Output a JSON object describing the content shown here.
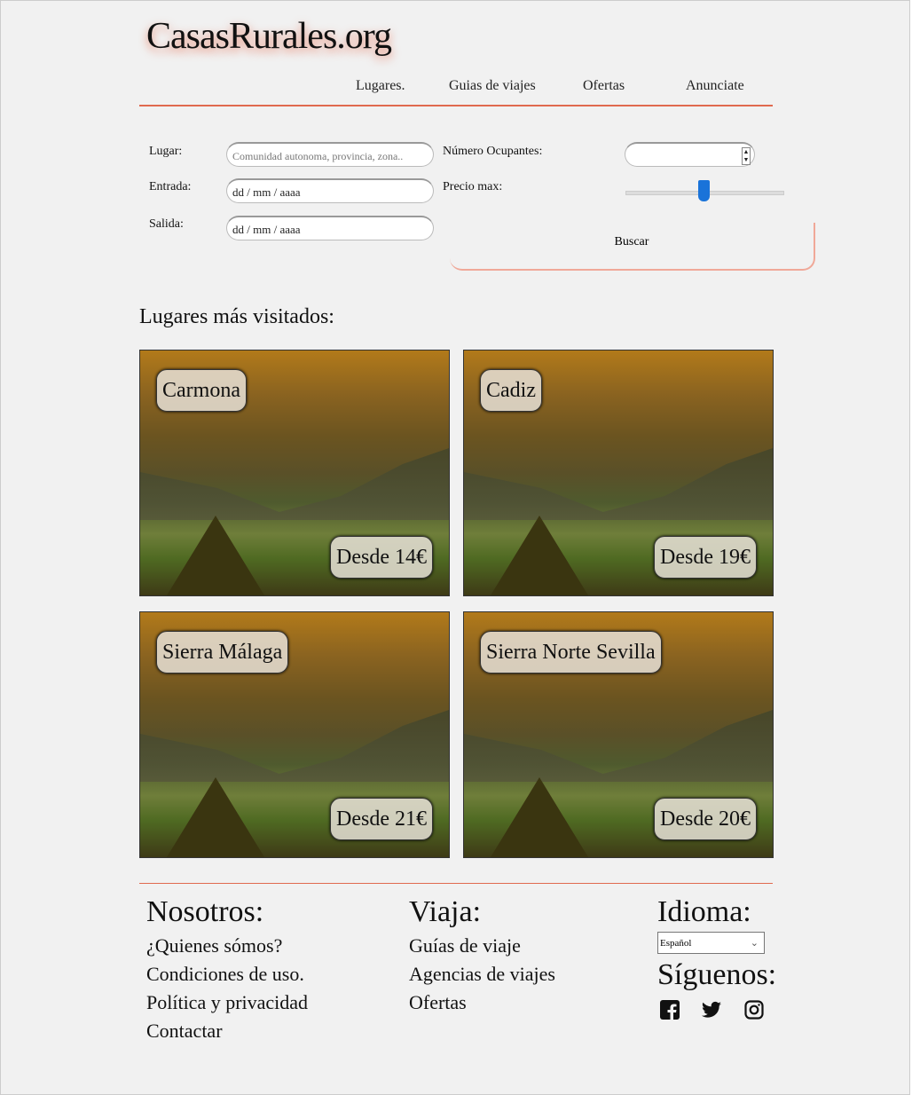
{
  "header": {
    "logo": "CasasRurales.org",
    "nav": [
      "Lugares.",
      "Guias de viajes",
      "Ofertas",
      "Anunciate"
    ]
  },
  "search": {
    "lugar_label": "Lugar:",
    "lugar_placeholder": "Comunidad autonoma, provincia, zona..",
    "entrada_label": "Entrada:",
    "entrada_value": "dd / mm / aaaa",
    "salida_label": "Salida:",
    "salida_value": "dd / mm / aaaa",
    "ocupantes_label": "Número Ocupantes:",
    "precio_label": "Precio max:",
    "precio_slider_fraction": 0.5,
    "buscar": "Buscar"
  },
  "section_title": "Lugares más visitados:",
  "places": [
    {
      "name": "Carmona",
      "price": "Desde 14€"
    },
    {
      "name": "Cadiz",
      "price": "Desde 19€"
    },
    {
      "name": "Sierra Málaga",
      "price": "Desde 21€"
    },
    {
      "name": "Sierra Norte Sevilla",
      "price": "Desde 20€"
    }
  ],
  "footer": {
    "nosotros_title": "Nosotros:",
    "nosotros": [
      "¿Quienes sómos?",
      "Condiciones de uso.",
      "Política y privacidad",
      "Contactar"
    ],
    "viaja_title": "Viaja:",
    "viaja": [
      "Guías de viaje",
      "Agencias de viajes",
      "Ofertas"
    ],
    "idioma_title": "Idioma:",
    "idioma_value": "Español",
    "siguenos_title": "Síguenos:",
    "social_icons": [
      "facebook-icon",
      "twitter-icon",
      "instagram-icon"
    ]
  }
}
